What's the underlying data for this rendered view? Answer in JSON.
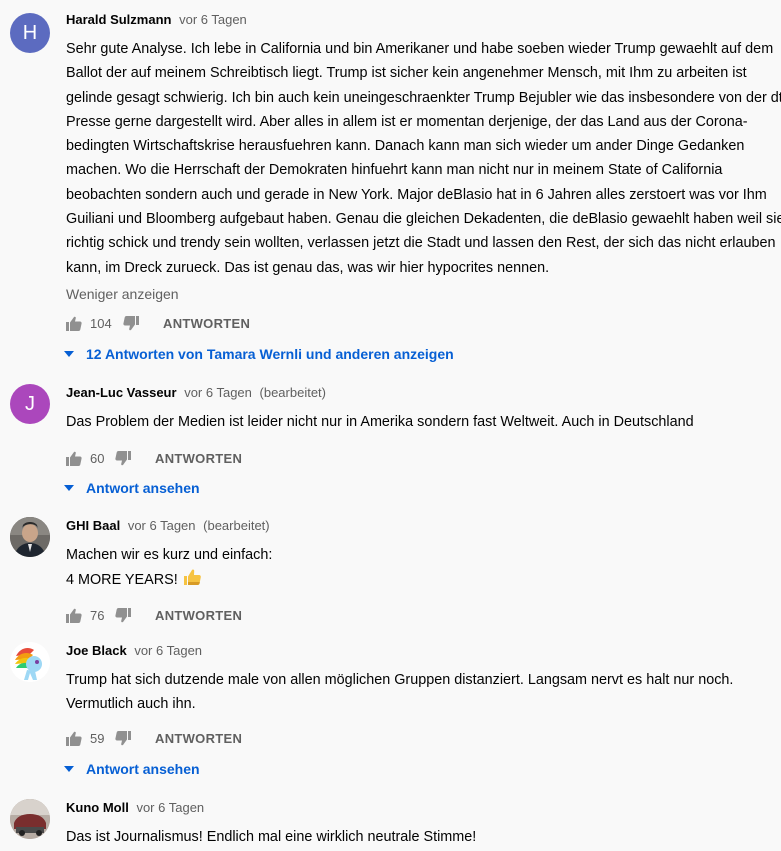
{
  "comments": [
    {
      "author": "Harald Sulzmann",
      "time": "vor 6 Tagen",
      "edited": "",
      "avatar_letter": "H",
      "avatar_color": "#5c6bc0",
      "text_lines": [
        "Sehr gute Analyse. Ich lebe in California und bin Amerikaner und habe soeben wieder Trump gewaehlt auf dem",
        "Ballot der auf meinem Schreibtisch liegt. Trump ist sicher kein angenehmer Mensch, mit Ihm zu arbeiten ist",
        "gelinde gesagt schwierig. Ich bin auch kein uneingeschraenkter Trump Bejubler wie das insbesondere von der dt.",
        "Presse gerne dargestellt wird. Aber alles in allem ist er momentan derjenige, der das Land aus der Corona-",
        "bedingten Wirtschaftskrise herausfuehren kann. Danach kann man sich wieder um ander Dinge Gedanken",
        "machen. Wo die Herrschaft der Demokraten hinfuehrt kann man nicht nur in meinem State of California",
        "beobachten sondern auch und gerade in New York. Major deBlasio hat in 6 Jahren alles zerstoert was vor Ihm",
        "Guiliani und Bloomberg aufgebaut haben. Genau die gleichen Dekadenten, die deBlasio gewaehlt haben weil sie so",
        "richtig schick und trendy sein wollten, verlassen jetzt die Stadt und lassen den Rest, der sich das nicht erlauben",
        "kann, im Dreck zurueck. Das ist genau das, was wir hier hypocrites nennen."
      ],
      "show_less": "Weniger anzeigen",
      "likes": "104",
      "reply_label": "ANTWORTEN",
      "replies_label": "12 Antworten von Tamara Wernli und anderen anzeigen"
    },
    {
      "author": "Jean-Luc Vasseur",
      "time": "vor 6 Tagen",
      "edited": "(bearbeitet)",
      "avatar_letter": "J",
      "avatar_color": "#ab47bc",
      "text_lines": [
        "Das Problem der Medien ist leider nicht nur in Amerika sondern fast Weltweit. Auch in Deutschland"
      ],
      "likes": "60",
      "reply_label": "ANTWORTEN",
      "replies_label": "Antwort ansehen"
    },
    {
      "author": "GHI Baal",
      "time": "vor 6 Tagen",
      "edited": "(bearbeitet)",
      "avatar_letter": "",
      "avatar_color": "#3a3a3a",
      "text_lines": [
        "Machen wir es kurz und einfach:",
        "4 MORE YEARS!"
      ],
      "likes": "76",
      "reply_label": "ANTWORTEN",
      "replies_label": ""
    },
    {
      "author": "Joe Black",
      "time": "vor 6 Tagen",
      "edited": "",
      "avatar_letter": "",
      "avatar_color": "#ffffff",
      "text_lines": [
        "Trump hat sich dutzende male von allen möglichen Gruppen distanziert. Langsam nervt es halt nur noch.",
        "Vermutlich auch ihn."
      ],
      "likes": "59",
      "reply_label": "ANTWORTEN",
      "replies_label": "Antwort ansehen"
    },
    {
      "author": "Kuno Moll",
      "time": "vor 6 Tagen",
      "edited": "",
      "avatar_letter": "",
      "avatar_color": "#9e8f86",
      "text_lines": [
        "Das ist Journalismus! Endlich mal eine wirklich neutrale Stimme!"
      ],
      "likes": "",
      "reply_label": "",
      "replies_label": ""
    }
  ],
  "icons": {
    "like": "thumbs-up-icon",
    "dislike": "thumbs-down-icon",
    "expand": "caret-down-icon",
    "emoji": "thumbs-up-emoji"
  },
  "colors": {
    "background": "#f9f9f9",
    "link_blue": "#065fd4",
    "meta_gray": "#606060"
  }
}
